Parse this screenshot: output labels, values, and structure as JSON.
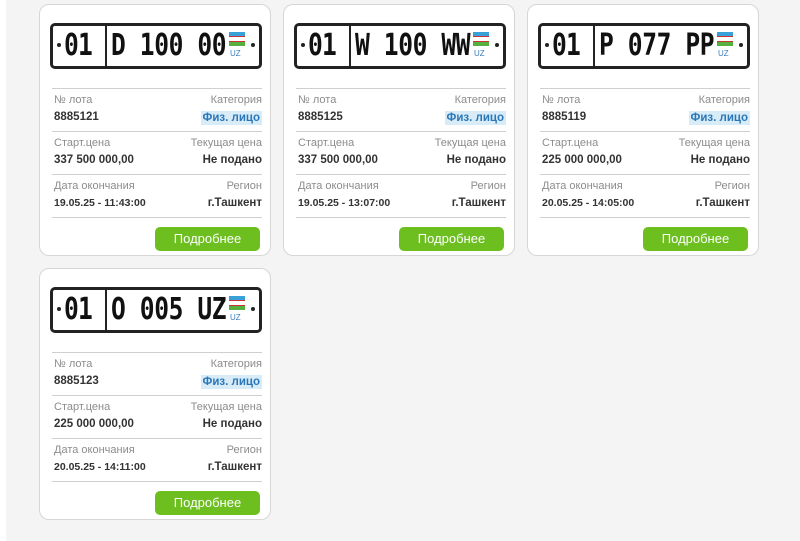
{
  "labels": {
    "lot_no": "№ лота",
    "category": "Категория",
    "start_price": "Старт.цена",
    "current_price": "Текущая цена",
    "end_date": "Дата окончания",
    "region": "Регион",
    "details_button": "Подробнее"
  },
  "plate_country_code": "UZ",
  "lots": [
    {
      "plate_region": "01",
      "plate_number": "D 100 00",
      "lot_no": "8885121",
      "category": "Физ. лицо",
      "start_price": "337 500 000,00",
      "current_price": "Не подано",
      "end_date": "19.05.25 - 11:43:00",
      "region": "г.Ташкент"
    },
    {
      "plate_region": "01",
      "plate_number": "W 100 WW",
      "lot_no": "8885125",
      "category": "Физ. лицо",
      "start_price": "337 500 000,00",
      "current_price": "Не подано",
      "end_date": "19.05.25 - 13:07:00",
      "region": "г.Ташкент"
    },
    {
      "plate_region": "01",
      "plate_number": "P 077 PP",
      "lot_no": "8885119",
      "category": "Физ. лицо",
      "start_price": "225 000 000,00",
      "current_price": "Не подано",
      "end_date": "20.05.25 - 14:05:00",
      "region": "г.Ташкент"
    },
    {
      "plate_region": "01",
      "plate_number": "O 005 UZ",
      "lot_no": "8885123",
      "category": "Физ. лицо",
      "start_price": "225 000 000,00",
      "current_price": "Не подано",
      "end_date": "20.05.25 - 14:11:00",
      "region": "г.Ташкент"
    }
  ],
  "colors": {
    "button": "#6cbf1f",
    "category_bg": "#d8ecf8",
    "category_text": "#2a77b8",
    "flag_blue": "#3aa0d8",
    "flag_green": "#55b040"
  }
}
